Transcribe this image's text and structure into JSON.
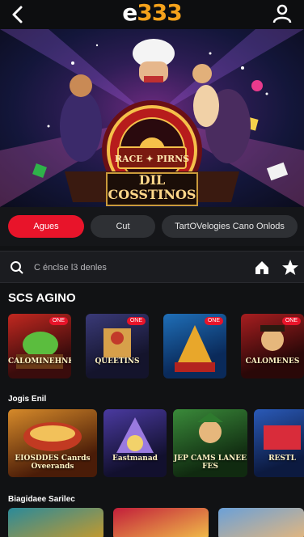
{
  "header": {
    "logo_main": "e",
    "logo_accent": "333",
    "back_icon": "chevron-left-icon",
    "user_icon": "user-icon"
  },
  "hero": {
    "sign_line1": "RACE ✦ PIRNS",
    "title": "DIL COSSTINOS"
  },
  "chips": [
    "Agues",
    "Cut",
    "TartOVelogies Cano Onlods"
  ],
  "search": {
    "placeholder": "C énclse l3 denles",
    "home_icon": "home-icon",
    "star_icon": "star-icon"
  },
  "sections": {
    "s1_title": "SCS AGINO",
    "s2_title": "Jogis Enil",
    "s3_title": "Biagidaee Sarilec"
  },
  "row1": [
    {
      "label": "CALOMINEHNKS",
      "badge": "ONE"
    },
    {
      "label": "QUEETINS",
      "badge": "ONE"
    },
    {
      "label": "",
      "badge": "ONE"
    },
    {
      "label": "CALOMENES",
      "badge": "ONE"
    }
  ],
  "row2": [
    {
      "label": "EIOSDDES Canrds Oveerands"
    },
    {
      "label": "Eastmanad"
    },
    {
      "label": "JEP CAMS LANEE FES"
    },
    {
      "label": "RESTL"
    }
  ],
  "colors": {
    "accent": "#e8142a",
    "logo_orange": "#f5a21b",
    "background": "#111214",
    "chip_bg": "#2e3034"
  }
}
